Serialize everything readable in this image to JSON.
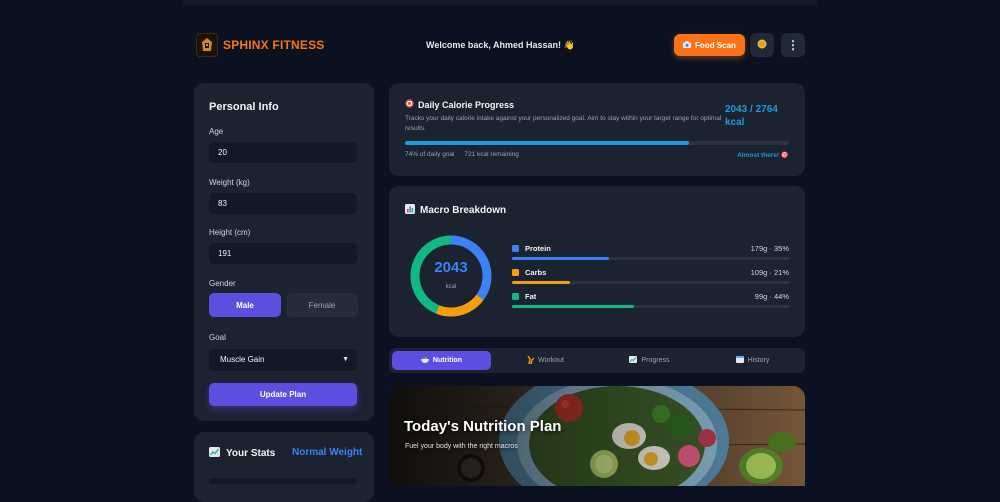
{
  "header": {
    "brand": "SPHINX FITNESS",
    "welcome": "Welcome back, Ahmed Hassan! 👋",
    "food_scan_label": "Food Scan",
    "food_scan_icon": "camera-icon",
    "coin_icon": "coin-icon",
    "menu_icon": "more-vertical-icon",
    "menu_glyph": "⋮"
  },
  "personal_info": {
    "title": "Personal Info",
    "age_label": "Age",
    "age_value": "20",
    "weight_label": "Weight (kg)",
    "weight_value": "83",
    "height_label": "Height (cm)",
    "height_value": "191",
    "gender_label": "Gender",
    "gender_male": "Male",
    "gender_female": "Female",
    "gender_selected": "Male",
    "goal_label": "Goal",
    "goal_value": "Muscle Gain",
    "update_label": "Update Plan"
  },
  "stats": {
    "title": "Your Stats",
    "badge": "Normal Weight",
    "icon": "chart-icon"
  },
  "calorie": {
    "title": "Daily Calorie Progress",
    "icon": "target-icon",
    "description": "Tracks your daily calorie intake against your personalized goal. Aim to stay within your target range for optimal results.",
    "value_line1": "2043 / 2764",
    "value_line2": "kcal",
    "progress": 0.74,
    "percent_text": "74% of daily goal",
    "remaining_text": "721 kcal remaining",
    "status": "Almost there! 🎯",
    "color": "#1e9bd7"
  },
  "macros": {
    "title": "Macro Breakdown",
    "icon": "bar-chart-icon",
    "total": "2043",
    "unit": "kcal",
    "items": [
      {
        "name": "Protein",
        "value": "179g · 35%",
        "color": "#3b82f6",
        "fraction": 0.35
      },
      {
        "name": "Carbs",
        "value": "109g · 21%",
        "color": "#f59e0b",
        "fraction": 0.21
      },
      {
        "name": "Fat",
        "value": "99g · 44%",
        "color": "#10b981",
        "fraction": 0.44
      }
    ]
  },
  "tabs": [
    {
      "label": "Nutrition",
      "icon": "bowl-icon",
      "active": true
    },
    {
      "label": "Workout",
      "icon": "muscle-icon",
      "active": false
    },
    {
      "label": "Progress",
      "icon": "chart-icon",
      "active": false
    },
    {
      "label": "History",
      "icon": "calendar-icon",
      "active": false
    }
  ],
  "hero": {
    "title": "Today's Nutrition Plan",
    "subtitle": "Fuel your body with the right macros"
  },
  "colors": {
    "accent": "#5b4fe0",
    "brand": "#f97316",
    "background": "#0b1120",
    "card": "#1b2230"
  }
}
